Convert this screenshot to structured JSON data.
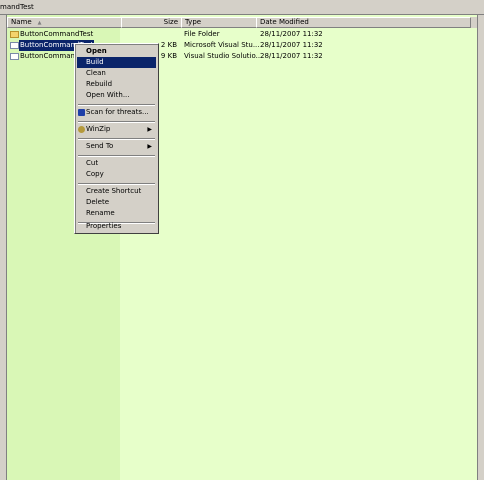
{
  "window": {
    "title_fragment": "mandTest"
  },
  "columns": {
    "name": "Name",
    "size": "Size",
    "type": "Type",
    "date": "Date Modified"
  },
  "files": [
    {
      "name": "ButtonCommandTest",
      "size": "",
      "type": "File Folder",
      "date": "28/11/2007 11:32",
      "icon": "folder-icon"
    },
    {
      "name": "ButtonCommandTest",
      "size": "2 KB",
      "type": "Microsoft Visual Stu...",
      "date": "28/11/2007 11:32",
      "icon": "project-file-icon"
    },
    {
      "name": "ButtonCommandT",
      "size": "9 KB",
      "type": "Visual Studio Solutio...",
      "date": "28/11/2007 11:32",
      "icon": "solution-file-icon"
    }
  ],
  "context_menu": {
    "items": [
      {
        "label": "Open"
      },
      {
        "label": "Build"
      },
      {
        "label": "Clean"
      },
      {
        "label": "Rebuild"
      },
      {
        "label": "Open With..."
      },
      {
        "label": "Scan for threats..."
      },
      {
        "label": "WinZip"
      },
      {
        "label": "Send To"
      },
      {
        "label": "Cut"
      },
      {
        "label": "Copy"
      },
      {
        "label": "Create Shortcut"
      },
      {
        "label": "Delete"
      },
      {
        "label": "Rename"
      },
      {
        "label": "Properties"
      }
    ],
    "highlighted": "Build",
    "submenu_arrow": "▶"
  },
  "colors": {
    "pane_bg": "#e7ffca",
    "name_col_bg": "#d9f7b6",
    "selection": "#0a246a"
  }
}
